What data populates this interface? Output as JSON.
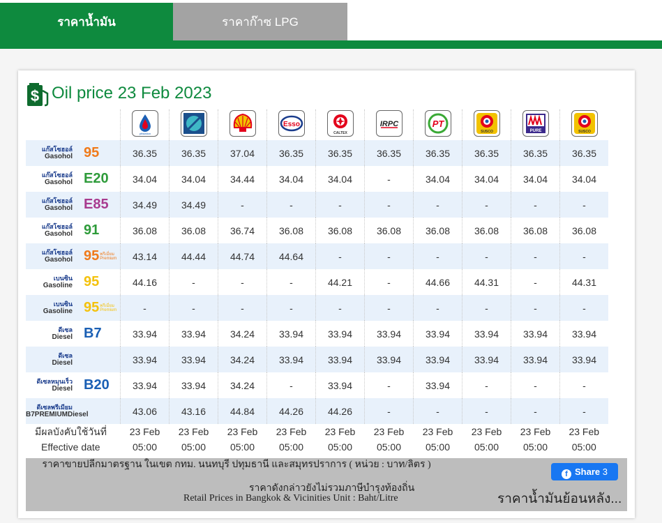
{
  "tabs": [
    {
      "label": "ราคาน้ำมัน"
    },
    {
      "label": "ราคาก๊าซ LPG"
    }
  ],
  "title": "Oil price 23 Feb 2023",
  "brands": [
    {
      "name": "PTT",
      "color": "#1a5fb4",
      "icon": "ptt-logo-icon"
    },
    {
      "name": "Bangchak",
      "color": "#17a2b8",
      "icon": "bangchak-logo-icon"
    },
    {
      "name": "Shell",
      "color": "#f2c200",
      "icon": "shell-logo-icon"
    },
    {
      "name": "Esso",
      "color": "#e3001b",
      "icon": "esso-logo-icon"
    },
    {
      "name": "Caltex",
      "color": "#e3001b",
      "icon": "caltex-logo-icon"
    },
    {
      "name": "IRPC",
      "color": "#1a3c8c",
      "icon": "irpc-logo-icon"
    },
    {
      "name": "PT",
      "color": "#3aa935",
      "icon": "pt-logo-icon"
    },
    {
      "name": "Susco",
      "color": "#e3001b",
      "icon": "susco-logo-icon"
    },
    {
      "name": "Pure",
      "color": "#3c2a8c",
      "icon": "pure-logo-icon"
    },
    {
      "name": "Susco Dealer",
      "color": "#e3001b",
      "icon": "susco-dealer-logo-icon"
    }
  ],
  "brand_logo_text": {
    "ptt": "pttstation",
    "caltex": "CALTEX",
    "irpc": "IRPC",
    "susco": "SUSCO",
    "pure": "PURE",
    "susco2": "SUSCO"
  },
  "rows": [
    {
      "th": "แก๊สโซฮอล์",
      "en": "Gasohol",
      "code": "95",
      "code_color": "#f07a1a",
      "sub": "",
      "prices": [
        "36.35",
        "36.35",
        "37.04",
        "36.35",
        "36.35",
        "36.35",
        "36.35",
        "36.35",
        "36.35",
        "36.35"
      ]
    },
    {
      "th": "แก๊สโซฮอล์",
      "en": "Gasohol",
      "code": "E20",
      "code_color": "#2e9b3a",
      "sub": "",
      "prices": [
        "34.04",
        "34.04",
        "34.44",
        "34.04",
        "34.04",
        "-",
        "34.04",
        "34.04",
        "34.04",
        "34.04"
      ]
    },
    {
      "th": "แก๊สโซฮอล์",
      "en": "Gasohol",
      "code": "E85",
      "code_color": "#a83b8f",
      "sub": "",
      "prices": [
        "34.49",
        "34.49",
        "-",
        "-",
        "-",
        "-",
        "-",
        "-",
        "-",
        "-"
      ]
    },
    {
      "th": "แก๊สโซฮอล์",
      "en": "Gasohol",
      "code": "91",
      "code_color": "#2e9b3a",
      "sub": "",
      "prices": [
        "36.08",
        "36.08",
        "36.74",
        "36.08",
        "36.08",
        "36.08",
        "36.08",
        "36.08",
        "36.08",
        "36.08"
      ]
    },
    {
      "th": "แก๊สโซฮอล์",
      "en": "Gasohol",
      "code": "95",
      "code_color": "#f07a1a",
      "sub": "พรีเมี่ยม Premium",
      "prices": [
        "43.14",
        "44.44",
        "44.74",
        "44.64",
        "-",
        "-",
        "-",
        "-",
        "-",
        "-"
      ]
    },
    {
      "th": "เบนซิน",
      "en": "Gasoline",
      "code": "95",
      "code_color": "#f4c20d",
      "sub": "",
      "prices": [
        "44.16",
        "-",
        "-",
        "-",
        "44.21",
        "-",
        "44.66",
        "44.31",
        "-",
        "44.31"
      ]
    },
    {
      "th": "เบนซิน",
      "en": "Gasoline",
      "code": "95",
      "code_color": "#f4c20d",
      "sub": "พรีเมี่ยม Premium",
      "prices": [
        "-",
        "-",
        "-",
        "-",
        "-",
        "-",
        "-",
        "-",
        "-",
        "-"
      ]
    },
    {
      "th": "ดีเซล",
      "en": "Diesel",
      "code": "B7",
      "code_color": "#1a5fb4",
      "sub": "",
      "prices": [
        "33.94",
        "33.94",
        "34.24",
        "33.94",
        "33.94",
        "33.94",
        "33.94",
        "33.94",
        "33.94",
        "33.94"
      ]
    },
    {
      "th": "ดีเซล",
      "en": "Diesel",
      "code": "",
      "code_color": "#1a5fb4",
      "sub": "",
      "prices": [
        "33.94",
        "33.94",
        "34.24",
        "33.94",
        "33.94",
        "33.94",
        "33.94",
        "33.94",
        "33.94",
        "33.94"
      ]
    },
    {
      "th": "ดีเซลหมุนเร็ว",
      "en": "Diesel",
      "code": "B20",
      "code_color": "#1a5fb4",
      "sub": "",
      "prices": [
        "33.94",
        "33.94",
        "34.24",
        "-",
        "33.94",
        "-",
        "33.94",
        "-",
        "-",
        "-"
      ]
    },
    {
      "th": "ดีเซลพรีเมียม",
      "en": "B7PREMIUMDiesel",
      "code": "",
      "code_color": "#1a3c8c",
      "sub": "",
      "prices": [
        "43.06",
        "43.16",
        "44.84",
        "44.26",
        "44.26",
        "-",
        "-",
        "-",
        "-",
        "-"
      ]
    }
  ],
  "effective": {
    "label_th": "มีผลบังคับใช้วันที่",
    "label_en": "Effective date",
    "dates": [
      "23 Feb",
      "23 Feb",
      "23 Feb",
      "23 Feb",
      "23 Feb",
      "23 Feb",
      "23 Feb",
      "23 Feb",
      "23 Feb",
      "23 Feb"
    ],
    "times": [
      "05:00",
      "05:00",
      "05:00",
      "05:00",
      "05:00",
      "05:00",
      "05:00",
      "05:00",
      "05:00",
      "05:00"
    ]
  },
  "footer": {
    "line1": "ราคาขายปลีกมาตรฐาน ในเขต กทม. นนทบุรี ปทุมธานี และสมุทรปราการ ( หน่วย : บาท/ลิตร )",
    "line2": "ราคาดังกล่าวยังไม่รวมภาษีบำรุงท้องถิ่น",
    "line3": "Retail Prices in Bangkok & Vicinities Unit : Baht/Litre",
    "share_label": "Share",
    "share_count": "3",
    "history_link": "ราคาน้ำมันย้อนหลัง..."
  }
}
